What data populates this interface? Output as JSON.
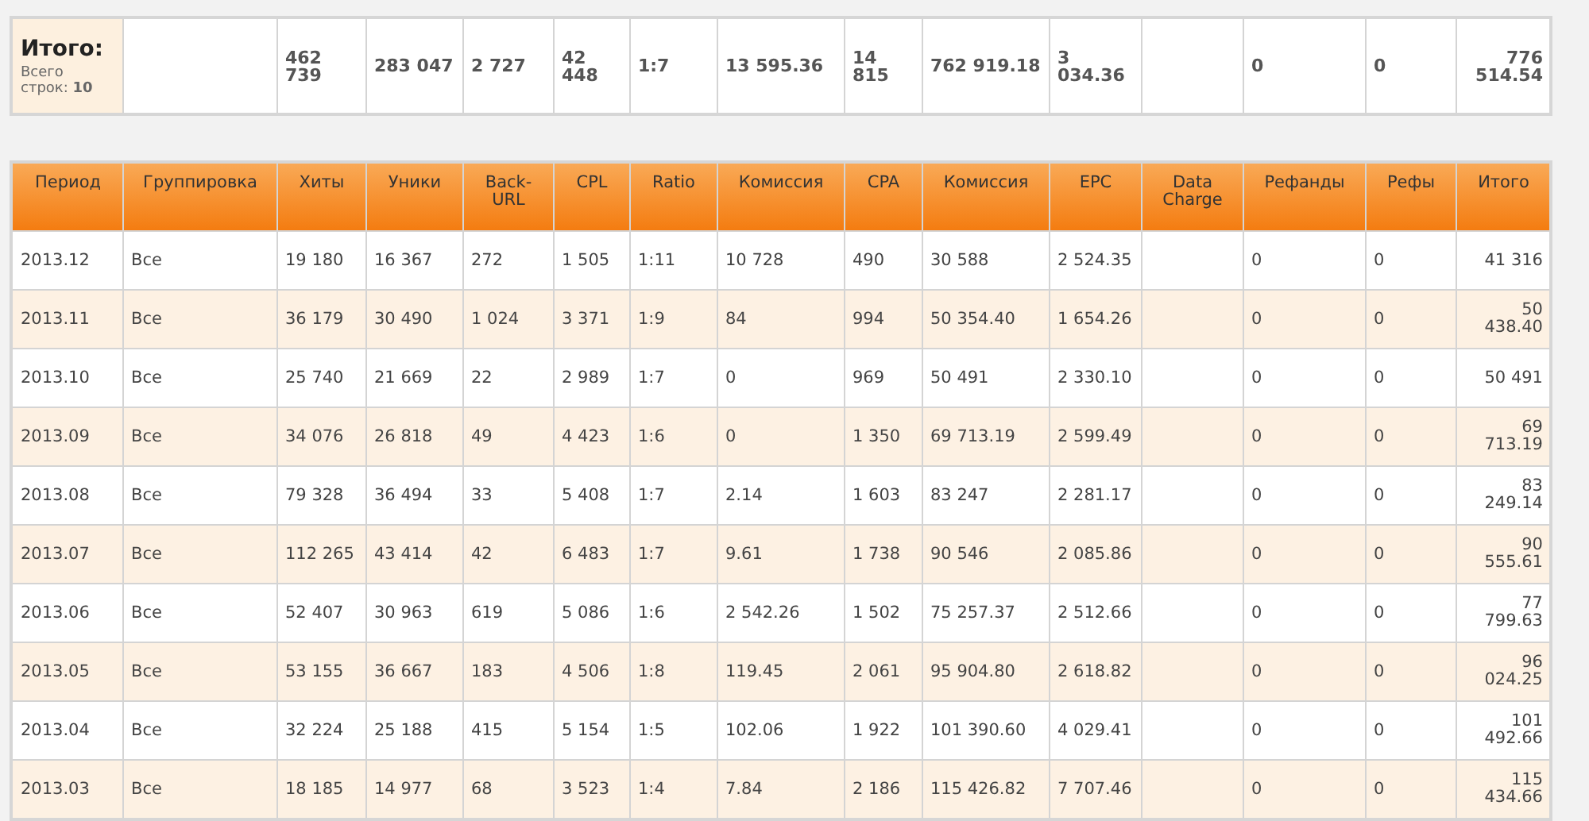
{
  "summary": {
    "label": "Итого:",
    "note": "Всего строк: **10**",
    "cells": [
      null,
      "462 739",
      "283 047",
      "2 727",
      "42 448",
      "1:7",
      "13 595.36",
      "14 815",
      "762 919.18",
      "3 034.36",
      null,
      "0",
      "0",
      "776 514.54"
    ]
  },
  "table": {
    "columns": [
      "Период",
      "Группировка",
      "Хиты",
      "Уники",
      "Back-URL",
      "CPL",
      "Ratio",
      "Комиссия",
      "CPA",
      "Комиссия",
      "EPC",
      "Data Charge",
      "Рефанды",
      "Рефы",
      "Итого"
    ],
    "rows": [
      [
        "2013.12",
        "Все",
        "19 180",
        "16 367",
        "272",
        "1 505",
        "1:11",
        "10 728",
        "490",
        "30 588",
        "2 524.35",
        null,
        "0",
        "0",
        "41 316"
      ],
      [
        "2013.11",
        "Все",
        "36 179",
        "30 490",
        "1 024",
        "3 371",
        "1:9",
        "84",
        "994",
        "50 354.40",
        "1 654.26",
        null,
        "0",
        "0",
        "50 438.40"
      ],
      [
        "2013.10",
        "Все",
        "25 740",
        "21 669",
        "22",
        "2 989",
        "1:7",
        "0",
        "969",
        "50 491",
        "2 330.10",
        null,
        "0",
        "0",
        "50 491"
      ],
      [
        "2013.09",
        "Все",
        "34 076",
        "26 818",
        "49",
        "4 423",
        "1:6",
        "0",
        "1 350",
        "69 713.19",
        "2 599.49",
        null,
        "0",
        "0",
        "69 713.19"
      ],
      [
        "2013.08",
        "Все",
        "79 328",
        "36 494",
        "33",
        "5 408",
        "1:7",
        "2.14",
        "1 603",
        "83 247",
        "2 281.17",
        null,
        "0",
        "0",
        "83 249.14"
      ],
      [
        "2013.07",
        "Все",
        "112 265",
        "43 414",
        "42",
        "6 483",
        "1:7",
        "9.61",
        "1 738",
        "90 546",
        "2 085.86",
        null,
        "0",
        "0",
        "90 555.61"
      ],
      [
        "2013.06",
        "Все",
        "52 407",
        "30 963",
        "619",
        "5 086",
        "1:6",
        "2 542.26",
        "1 502",
        "75 257.37",
        "2 512.66",
        null,
        "0",
        "0",
        "77 799.63"
      ],
      [
        "2013.05",
        "Все",
        "53 155",
        "36 667",
        "183",
        "4 506",
        "1:8",
        "119.45",
        "2 061",
        "95 904.80",
        "2 618.82",
        null,
        "0",
        "0",
        "96 024.25"
      ],
      [
        "2013.04",
        "Все",
        "32 224",
        "25 188",
        "415",
        "5 154",
        "1:5",
        "102.06",
        "1 922",
        "101 390.60",
        "4 029.41",
        null,
        "0",
        "0",
        "101 492.66"
      ],
      [
        "2013.03",
        "Все",
        "18 185",
        "14 977",
        "68",
        "3 523",
        "1:4",
        "7.84",
        "2 186",
        "115 426.82",
        "7 707.46",
        null,
        "0",
        "0",
        "115 434.66"
      ]
    ]
  }
}
